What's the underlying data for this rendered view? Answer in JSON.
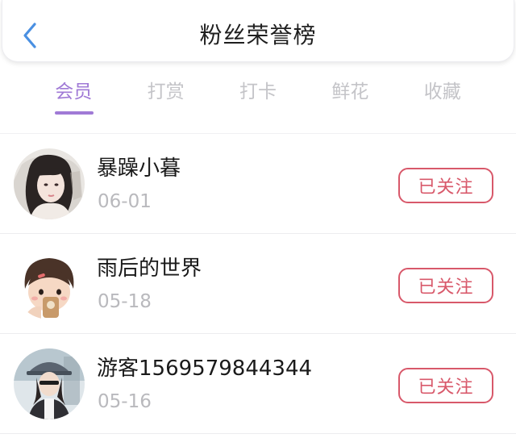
{
  "header": {
    "title": "粉丝荣誉榜",
    "back_icon": "chevron-left-icon"
  },
  "colors": {
    "accent": "#a07ad6",
    "follow": "#d8586a",
    "back": "#4a90e2"
  },
  "tabs": [
    {
      "label": "会员",
      "active": true
    },
    {
      "label": "打赏",
      "active": false
    },
    {
      "label": "打卡",
      "active": false
    },
    {
      "label": "鲜花",
      "active": false
    },
    {
      "label": "收藏",
      "active": false
    }
  ],
  "fans": [
    {
      "name": "暴躁小暮",
      "date": "06-01",
      "follow_label": "已关注"
    },
    {
      "name": "雨后的世界",
      "date": "05-18",
      "follow_label": "已关注"
    },
    {
      "name": "游客1569579844344",
      "date": "05-16",
      "follow_label": "已关注"
    }
  ]
}
